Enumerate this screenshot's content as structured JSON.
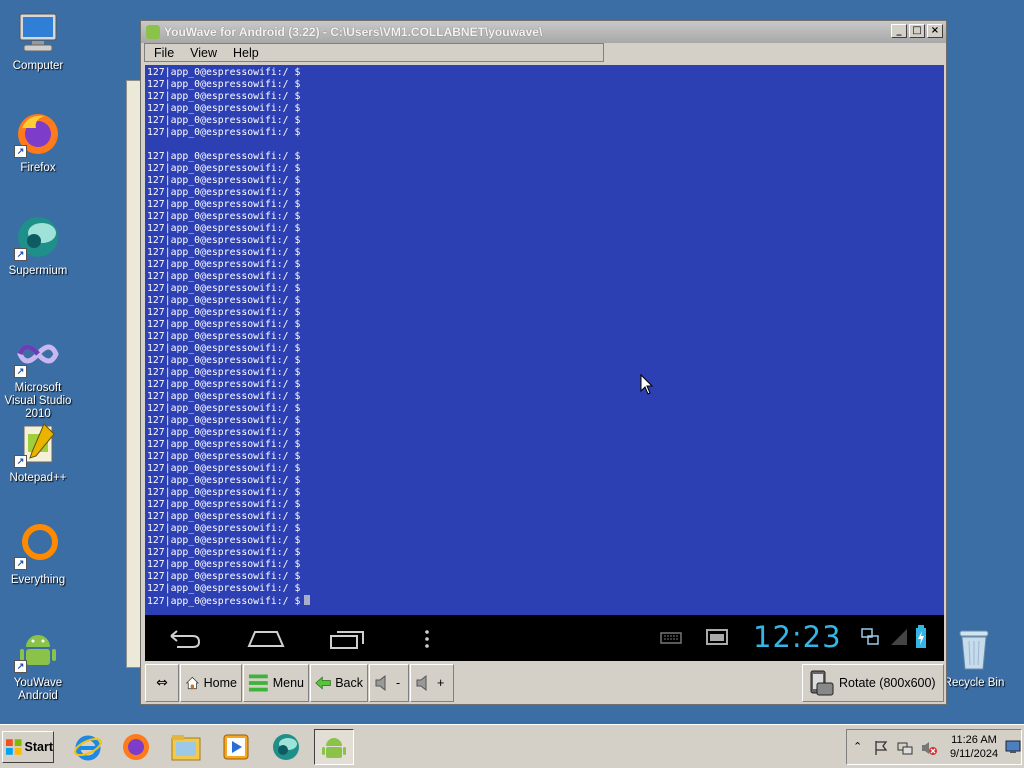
{
  "desktop": {
    "icons": [
      {
        "label": "Computer",
        "icon": "computer-icon"
      },
      {
        "label": "Firefox",
        "icon": "firefox-icon"
      },
      {
        "label": "Supermium",
        "icon": "supermium-icon"
      },
      {
        "label": "Microsoft Visual Studio 2010",
        "icon": "visual-studio-icon"
      },
      {
        "label": "Notepad++",
        "icon": "notepad-plus-plus-icon"
      },
      {
        "label": "Everything",
        "icon": "everything-icon"
      },
      {
        "label": "YouWave Android",
        "icon": "youwave-android-icon"
      },
      {
        "label": "Recycle Bin",
        "icon": "recycle-bin-icon"
      }
    ]
  },
  "window": {
    "title": "YouWave for Android (3.22) - C:\\Users\\VM1.COLLABNET\\youwave\\",
    "menu": [
      "File",
      "View",
      "Help"
    ]
  },
  "terminal": {
    "prompt": "127|app_0@espressowifi:/ $",
    "lines_before_gap": 6,
    "lines_after_gap": 38
  },
  "navbar": {
    "clock": "12:23",
    "icons": [
      "back-icon",
      "home-icon",
      "recent-apps-icon",
      "more-icon",
      "keyboard-icon",
      "screen-icon",
      "network-icon",
      "signal-icon",
      "battery-icon"
    ]
  },
  "toolbar": {
    "home_label": "Home",
    "menu_label": "Menu",
    "back_label": "Back",
    "vol_down_label": "-",
    "vol_up_label": "+",
    "rotate_label": "Rotate (800x600)"
  },
  "taskbar": {
    "start_label": "Start",
    "time": "11:26 AM",
    "date": "9/11/2024"
  },
  "colors": {
    "desktop": "#3a6ea5",
    "screen": "#2c3fb3",
    "clock": "#33b5e5"
  }
}
